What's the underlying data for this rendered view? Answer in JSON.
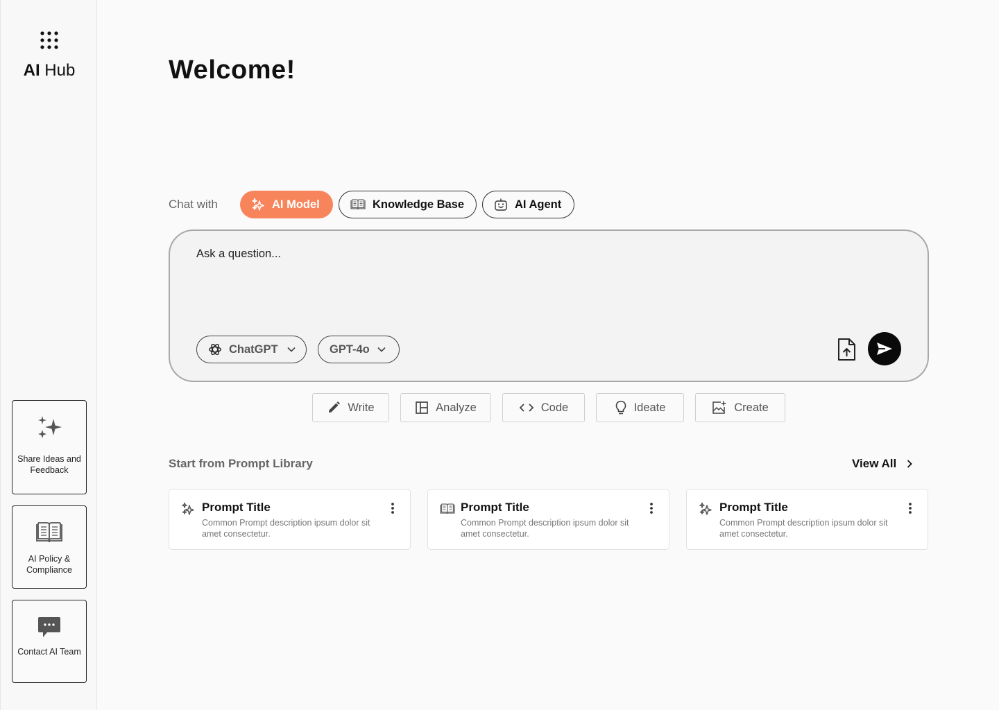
{
  "sidebar": {
    "brand_bold": "AI",
    "brand_rest": " Hub",
    "cards": [
      {
        "label": "Share Ideas and Feedback",
        "icon": "sparkles-icon"
      },
      {
        "label": "AI Policy & Compliance",
        "icon": "open-book-icon"
      },
      {
        "label": "Contact AI Team",
        "icon": "chat-bubble-icon"
      }
    ]
  },
  "main": {
    "title": "Welcome!",
    "chat_with_label": "Chat with",
    "modes": [
      {
        "label": "AI Model",
        "icon": "sparkles-icon",
        "active": true
      },
      {
        "label": "Knowledge Base",
        "icon": "book-icon",
        "active": false
      },
      {
        "label": "AI Agent",
        "icon": "robot-icon",
        "active": false
      }
    ],
    "chat": {
      "placeholder": "Ask a question...",
      "provider": "ChatGPT",
      "model": "GPT-4o"
    },
    "actions": [
      {
        "label": "Write",
        "icon": "pencil-icon"
      },
      {
        "label": "Analyze",
        "icon": "layout-icon"
      },
      {
        "label": "Code",
        "icon": "code-icon"
      },
      {
        "label": "Ideate",
        "icon": "lightbulb-icon"
      },
      {
        "label": "Create",
        "icon": "image-add-icon"
      }
    ],
    "library": {
      "title": "Start from Prompt Library",
      "view_all": "View All",
      "prompts": [
        {
          "title": "Prompt Title",
          "description": "Common Prompt description ipsum dolor sit amet consectetur.",
          "icon": "sparkles-icon"
        },
        {
          "title": "Prompt Title",
          "description": "Common Prompt description ipsum dolor sit amet consectetur.",
          "icon": "book-icon"
        },
        {
          "title": "Prompt Title",
          "description": "Common Prompt description ipsum dolor sit amet consectetur.",
          "icon": "sparkles-icon"
        }
      ]
    }
  },
  "colors": {
    "accent": "#f8845b",
    "send_button": "#0a0a0a"
  }
}
